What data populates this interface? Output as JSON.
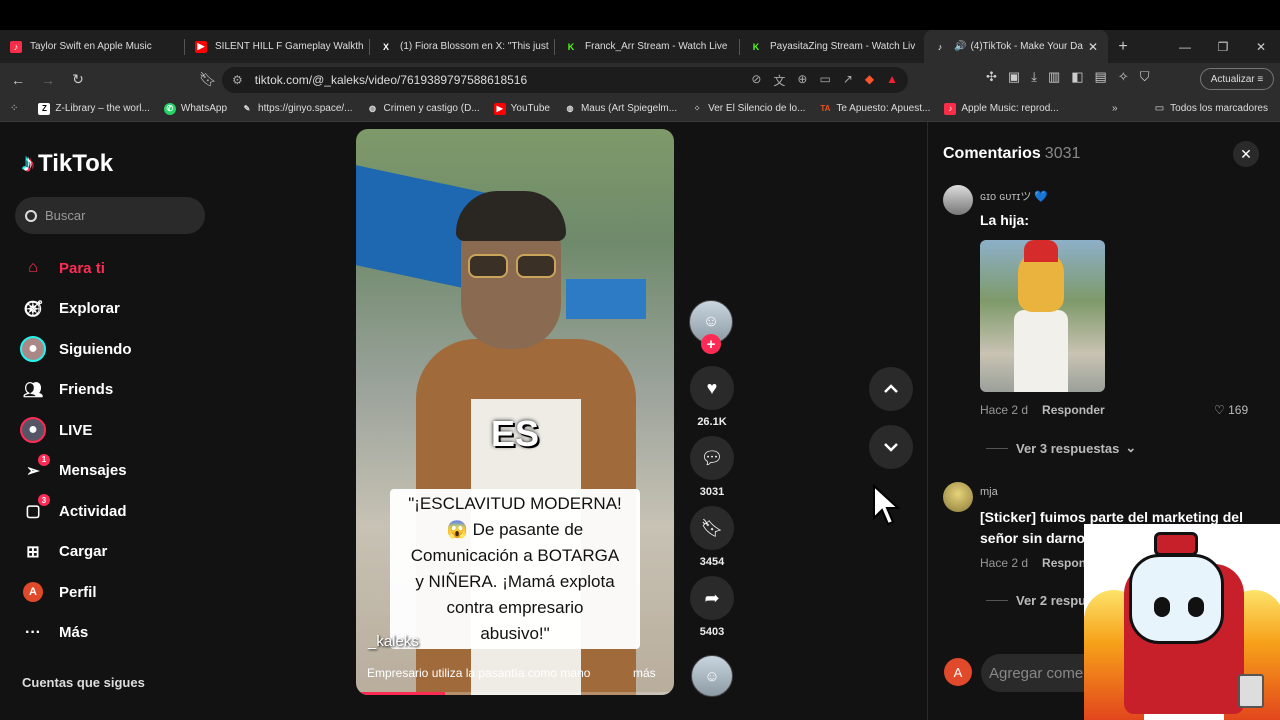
{
  "browser": {
    "tabs": [
      {
        "title": "Taylor Swift en Apple Music",
        "fav_color": "#fa2d48",
        "fav_glyph": "♪"
      },
      {
        "title": "SILENT HILL F Gameplay Walkth",
        "fav_color": "#ff0000",
        "fav_glyph": "▶"
      },
      {
        "title": "(1) Fiora Blossom en X: \"This just",
        "fav_color": "#000000",
        "fav_glyph": "X"
      },
      {
        "title": "Franck_Arr Stream - Watch Live",
        "fav_color": "#53fc18",
        "fav_glyph": "K"
      },
      {
        "title": "PayasitaZing Stream - Watch Liv",
        "fav_color": "#53fc18",
        "fav_glyph": "K"
      },
      {
        "title": "(4)TikTok - Make Your Da",
        "fav_color": "#000000",
        "fav_glyph": "♪"
      }
    ],
    "url": "tiktok.com/@_kaleks/video/7619389797588618516",
    "update_label": "Actualizar",
    "bookmarks": [
      {
        "label": "Z-Library – the worl...",
        "color": "#ffffff",
        "glyph": "Z"
      },
      {
        "label": "WhatsApp",
        "color": "#25d366",
        "glyph": "✆"
      },
      {
        "label": "https://ginyo.space/...",
        "color": "#444444",
        "glyph": "✎"
      },
      {
        "label": "Crimen y castigo (D...",
        "color": "#777777",
        "glyph": "◍"
      },
      {
        "label": "YouTube",
        "color": "#ff0000",
        "glyph": "▶"
      },
      {
        "label": "Maus (Art Spiegelm...",
        "color": "#777777",
        "glyph": "◍"
      },
      {
        "label": "Ver El Silencio de lo...",
        "color": "#444444",
        "glyph": "⁘"
      },
      {
        "label": "Te Apuesto: Apuest...",
        "color": "#e8521f",
        "glyph": "TA"
      },
      {
        "label": "Apple Music: reprod...",
        "color": "#fa2d48",
        "glyph": "♪"
      }
    ],
    "all_bookmarks": "Todos los marcadores"
  },
  "sidebar": {
    "logo": "TikTok",
    "search_placeholder": "Buscar",
    "nav": [
      {
        "label": "Para ti",
        "icon": "home-icon",
        "active": true
      },
      {
        "label": "Explorar",
        "icon": "compass-icon"
      },
      {
        "label": "Siguiendo",
        "icon": "following-avatar-icon"
      },
      {
        "label": "Friends",
        "icon": "friends-icon"
      },
      {
        "label": "LIVE",
        "icon": "live-icon"
      },
      {
        "label": "Mensajes",
        "icon": "messages-icon",
        "badge": "1"
      },
      {
        "label": "Actividad",
        "icon": "activity-icon",
        "badge": "3"
      },
      {
        "label": "Cargar",
        "icon": "upload-icon"
      },
      {
        "label": "Perfil",
        "icon": "profile-icon"
      },
      {
        "label": "Más",
        "icon": "more-icon"
      }
    ],
    "following_title": "Cuentas que sigues"
  },
  "video": {
    "overlay_word": "ES",
    "caption_lines": [
      "\"¡ESCLAVITUD MODERNA!",
      "😱 De pasante de",
      "Comunicación a BOTARGA",
      "y NIÑERA. ¡Mamá explota",
      "contra empresario",
      "abusivo!\""
    ],
    "watermark": "_kaleks",
    "description": "Empresario utiliza la pasantía como mano",
    "more": "más",
    "progress": 0.28
  },
  "actions": {
    "likes": "26.1K",
    "comments": "3031",
    "saves": "3454",
    "shares": "5403"
  },
  "comments_panel": {
    "title": "Comentarios",
    "count": "3031",
    "comments": [
      {
        "user": "ɢɪᴏ ɢᴜᴛɪツ 💙",
        "text": "La hija:",
        "time": "Hace 2 d",
        "reply": "Responder",
        "likes": "169",
        "view_replies": "Ver 3 respuestas"
      },
      {
        "user": "mja",
        "text": "[Sticker] fuimos parte del marketing del señor sin darnos",
        "time": "Hace 2 d",
        "reply": "Respon",
        "view_replies": "Ver 2 respu"
      }
    ],
    "input_placeholder": "Agregar come",
    "me_initial": "A"
  },
  "colors": {
    "accent": "#fe2c55",
    "background": "#121212"
  }
}
